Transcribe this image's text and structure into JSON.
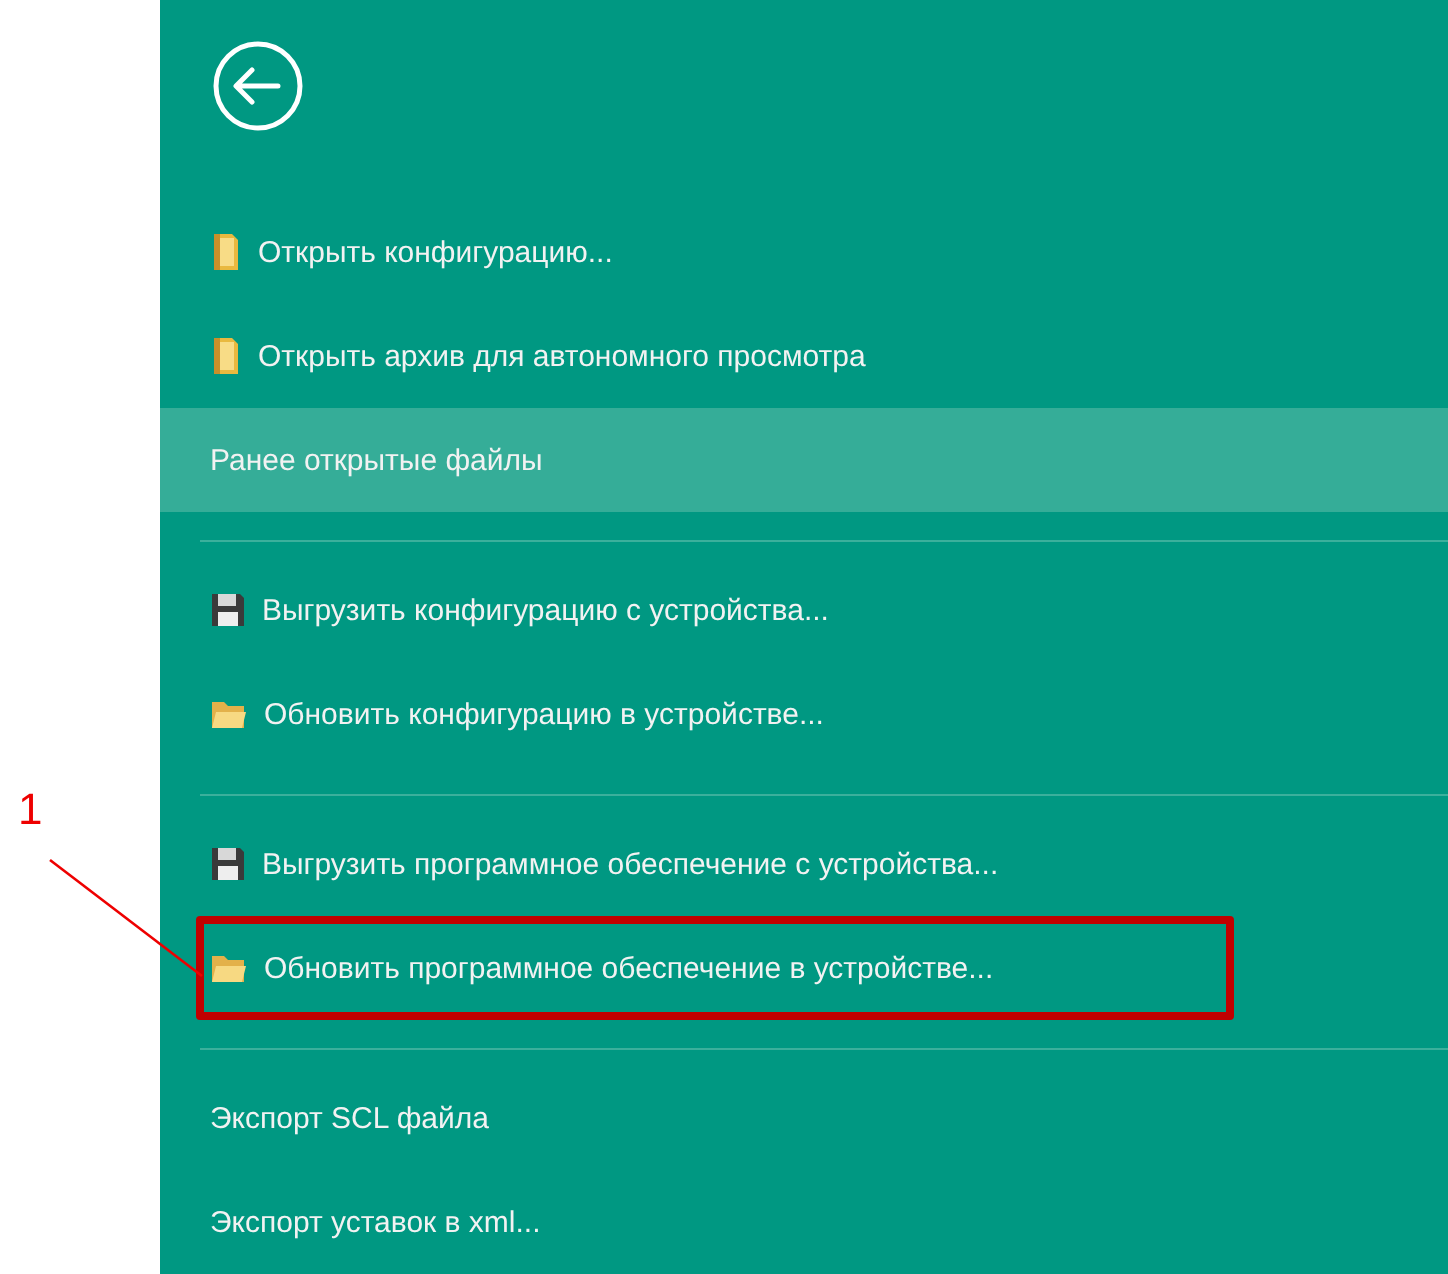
{
  "menu": {
    "groups": [
      {
        "items": [
          {
            "label": "Открыть конфигурацию...",
            "kind": "binder",
            "selected": false
          },
          {
            "label": "Открыть архив для автономного просмотра",
            "kind": "binder",
            "selected": false
          },
          {
            "label": "Ранее открытые файлы",
            "kind": "plain",
            "selected": true
          }
        ]
      },
      {
        "items": [
          {
            "label": "Выгрузить конфигурацию с устройства...",
            "kind": "floppy",
            "selected": false
          },
          {
            "label": "Обновить конфигурацию в устройстве...",
            "kind": "folder",
            "selected": false
          }
        ]
      },
      {
        "items": [
          {
            "label": "Выгрузить программное обеспечение с устройства...",
            "kind": "floppy",
            "selected": false
          },
          {
            "label": "Обновить программное обеспечение в устройстве...",
            "kind": "folder",
            "selected": false,
            "framed": true
          }
        ]
      },
      {
        "items": [
          {
            "label": "Экспорт SCL файла",
            "kind": "plain",
            "selected": false
          },
          {
            "label": "Экспорт уставок в xml...",
            "kind": "plain",
            "selected": false
          }
        ]
      }
    ]
  },
  "callout": {
    "label": "1"
  }
}
